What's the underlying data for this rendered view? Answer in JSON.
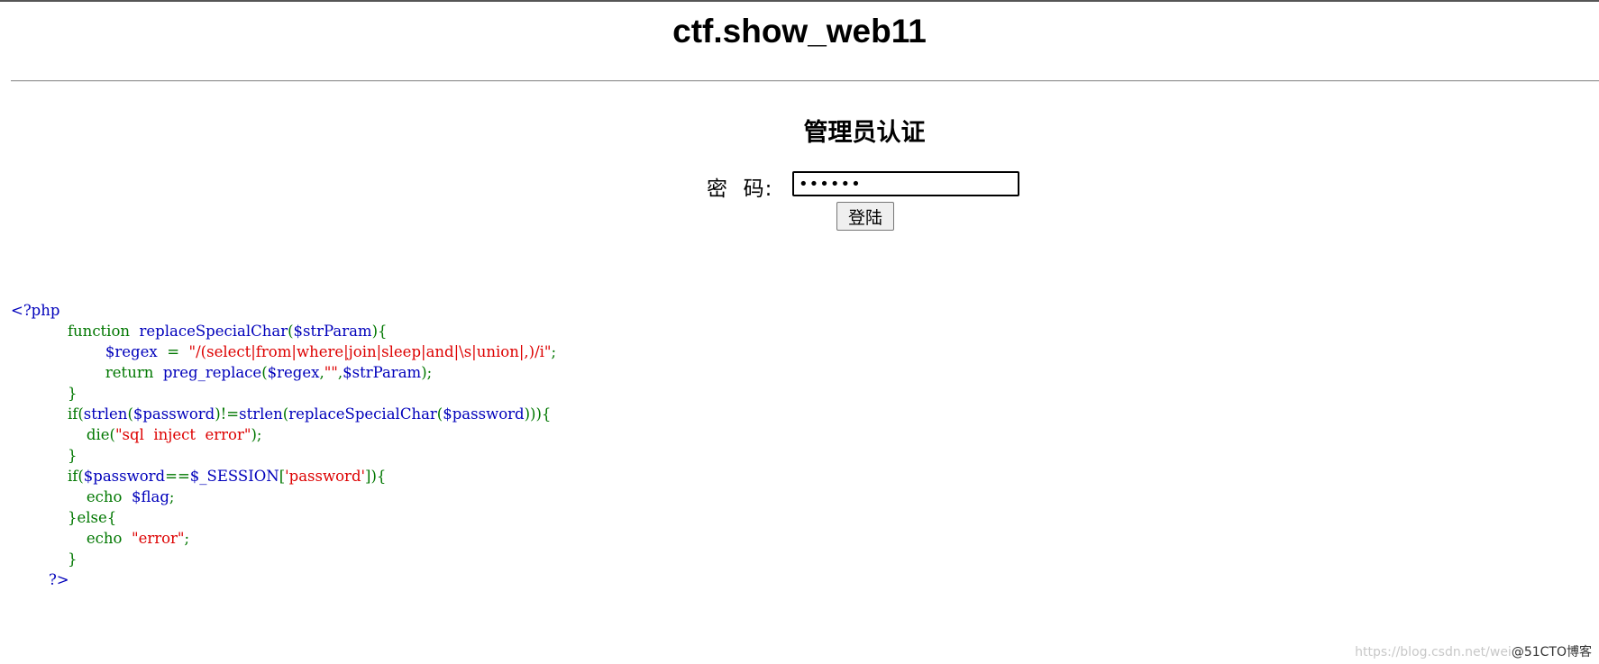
{
  "header": {
    "title": "ctf.show_web11"
  },
  "form": {
    "heading": "管理员认证",
    "password_label": "密  码:",
    "password_value": "••••••",
    "login_button": "登陆"
  },
  "code_lines": [
    [
      [
        "df",
        "<?php"
      ]
    ],
    [
      [
        "df",
        "            "
      ],
      [
        "kw",
        "function  "
      ],
      [
        "df",
        "replaceSpecialChar"
      ],
      [
        "pl",
        "("
      ],
      [
        "df",
        "$strParam"
      ],
      [
        "pl",
        "){"
      ]
    ],
    [
      [
        "df",
        "                    "
      ],
      [
        "df",
        "$regex  "
      ],
      [
        "pl",
        "=  "
      ],
      [
        "st",
        "\"/(select|from|where|join|sleep|and|\\s|union|,)/i\""
      ],
      [
        "pl",
        ";"
      ]
    ],
    [
      [
        "df",
        "                    "
      ],
      [
        "kw",
        "return  "
      ],
      [
        "df",
        "preg_replace"
      ],
      [
        "pl",
        "("
      ],
      [
        "df",
        "$regex"
      ],
      [
        "pl",
        ","
      ],
      [
        "st",
        "\"\""
      ],
      [
        "pl",
        ","
      ],
      [
        "df",
        "$strParam"
      ],
      [
        "pl",
        ");"
      ]
    ],
    [
      [
        "df",
        "            "
      ],
      [
        "pl",
        "}"
      ]
    ],
    [
      [
        "df",
        "            "
      ],
      [
        "kw",
        "if"
      ],
      [
        "pl",
        "("
      ],
      [
        "df",
        "strlen"
      ],
      [
        "pl",
        "("
      ],
      [
        "df",
        "$password"
      ],
      [
        "pl",
        ")!="
      ],
      [
        "df",
        "strlen"
      ],
      [
        "pl",
        "("
      ],
      [
        "df",
        "replaceSpecialChar"
      ],
      [
        "pl",
        "("
      ],
      [
        "df",
        "$password"
      ],
      [
        "pl",
        "))){"
      ]
    ],
    [
      [
        "df",
        "                "
      ],
      [
        "kw",
        "die"
      ],
      [
        "pl",
        "("
      ],
      [
        "st",
        "\"sql  inject  error\""
      ],
      [
        "pl",
        ");"
      ]
    ],
    [
      [
        "df",
        "            "
      ],
      [
        "pl",
        "}"
      ]
    ],
    [
      [
        "df",
        "            "
      ],
      [
        "kw",
        "if"
      ],
      [
        "pl",
        "("
      ],
      [
        "df",
        "$password"
      ],
      [
        "pl",
        "=="
      ],
      [
        "df",
        "$_SESSION"
      ],
      [
        "pl",
        "["
      ],
      [
        "st",
        "'password'"
      ],
      [
        "pl",
        "]){"
      ]
    ],
    [
      [
        "df",
        "                "
      ],
      [
        "kw",
        "echo  "
      ],
      [
        "df",
        "$flag"
      ],
      [
        "pl",
        ";"
      ]
    ],
    [
      [
        "df",
        "            "
      ],
      [
        "pl",
        "}else{"
      ]
    ],
    [
      [
        "df",
        "                "
      ],
      [
        "kw",
        "echo  "
      ],
      [
        "st",
        "\"error\""
      ],
      [
        "pl",
        ";"
      ]
    ],
    [
      [
        "df",
        "            "
      ],
      [
        "pl",
        "}"
      ]
    ],
    [
      [
        "df",
        "        ?>"
      ]
    ]
  ],
  "watermark": {
    "faint": "https://blog.csdn.net/wei",
    "text": "@51CTO博客"
  }
}
